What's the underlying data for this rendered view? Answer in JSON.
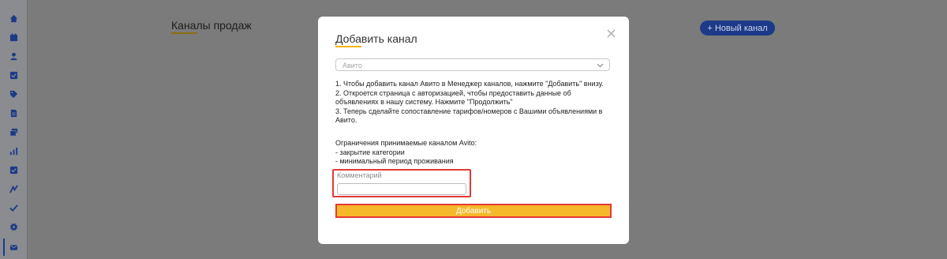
{
  "sidebar": {
    "icons": [
      "home-icon",
      "calendar-icon",
      "user-icon",
      "checkbox-icon",
      "tag-icon",
      "document-icon",
      "layers-icon",
      "bar-chart-icon",
      "task-icon",
      "route-icon",
      "check-icon",
      "gear-icon",
      "mail-icon"
    ],
    "active": "mail-icon"
  },
  "page": {
    "title": "Каналы продаж",
    "new_channel_button": "+ Новый канал"
  },
  "modal": {
    "title": "Добавить канал",
    "select_value": "Авито",
    "instructions": [
      "1. Чтобы добавить канал Авито в Менеджер каналов, нажмите \"Добавить\" внизу.",
      "2. Откроется страница с авторизацией, чтобы предоставить данные об объявлениях в нашу систему. Нажмите \"Продолжить\"",
      "3. Теперь сделайте сопоставление тарифов/номеров с Вашими объявлениями в Авито."
    ],
    "limits_title": "Ограничения принимаемые каналом Avito:",
    "limits": [
      "- закрытие категории",
      "- минимальный период проживания"
    ],
    "comment_label": "Комментарий",
    "comment_value": "",
    "submit_label": "Добавить"
  },
  "colors": {
    "overlay": "#7b7b7b",
    "accent_button": "#f5b82a",
    "highlight": "#e53935",
    "primary": "#1d3a88"
  }
}
